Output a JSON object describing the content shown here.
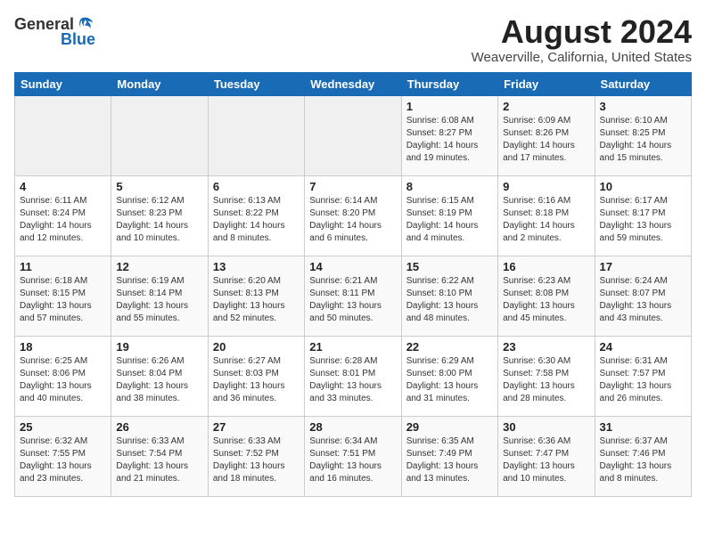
{
  "header": {
    "logo_general": "General",
    "logo_blue": "Blue",
    "month_year": "August 2024",
    "location": "Weaverville, California, United States"
  },
  "weekdays": [
    "Sunday",
    "Monday",
    "Tuesday",
    "Wednesday",
    "Thursday",
    "Friday",
    "Saturday"
  ],
  "weeks": [
    [
      {
        "day": "",
        "info": ""
      },
      {
        "day": "",
        "info": ""
      },
      {
        "day": "",
        "info": ""
      },
      {
        "day": "",
        "info": ""
      },
      {
        "day": "1",
        "info": "Sunrise: 6:08 AM\nSunset: 8:27 PM\nDaylight: 14 hours\nand 19 minutes."
      },
      {
        "day": "2",
        "info": "Sunrise: 6:09 AM\nSunset: 8:26 PM\nDaylight: 14 hours\nand 17 minutes."
      },
      {
        "day": "3",
        "info": "Sunrise: 6:10 AM\nSunset: 8:25 PM\nDaylight: 14 hours\nand 15 minutes."
      }
    ],
    [
      {
        "day": "4",
        "info": "Sunrise: 6:11 AM\nSunset: 8:24 PM\nDaylight: 14 hours\nand 12 minutes."
      },
      {
        "day": "5",
        "info": "Sunrise: 6:12 AM\nSunset: 8:23 PM\nDaylight: 14 hours\nand 10 minutes."
      },
      {
        "day": "6",
        "info": "Sunrise: 6:13 AM\nSunset: 8:22 PM\nDaylight: 14 hours\nand 8 minutes."
      },
      {
        "day": "7",
        "info": "Sunrise: 6:14 AM\nSunset: 8:20 PM\nDaylight: 14 hours\nand 6 minutes."
      },
      {
        "day": "8",
        "info": "Sunrise: 6:15 AM\nSunset: 8:19 PM\nDaylight: 14 hours\nand 4 minutes."
      },
      {
        "day": "9",
        "info": "Sunrise: 6:16 AM\nSunset: 8:18 PM\nDaylight: 14 hours\nand 2 minutes."
      },
      {
        "day": "10",
        "info": "Sunrise: 6:17 AM\nSunset: 8:17 PM\nDaylight: 13 hours\nand 59 minutes."
      }
    ],
    [
      {
        "day": "11",
        "info": "Sunrise: 6:18 AM\nSunset: 8:15 PM\nDaylight: 13 hours\nand 57 minutes."
      },
      {
        "day": "12",
        "info": "Sunrise: 6:19 AM\nSunset: 8:14 PM\nDaylight: 13 hours\nand 55 minutes."
      },
      {
        "day": "13",
        "info": "Sunrise: 6:20 AM\nSunset: 8:13 PM\nDaylight: 13 hours\nand 52 minutes."
      },
      {
        "day": "14",
        "info": "Sunrise: 6:21 AM\nSunset: 8:11 PM\nDaylight: 13 hours\nand 50 minutes."
      },
      {
        "day": "15",
        "info": "Sunrise: 6:22 AM\nSunset: 8:10 PM\nDaylight: 13 hours\nand 48 minutes."
      },
      {
        "day": "16",
        "info": "Sunrise: 6:23 AM\nSunset: 8:08 PM\nDaylight: 13 hours\nand 45 minutes."
      },
      {
        "day": "17",
        "info": "Sunrise: 6:24 AM\nSunset: 8:07 PM\nDaylight: 13 hours\nand 43 minutes."
      }
    ],
    [
      {
        "day": "18",
        "info": "Sunrise: 6:25 AM\nSunset: 8:06 PM\nDaylight: 13 hours\nand 40 minutes."
      },
      {
        "day": "19",
        "info": "Sunrise: 6:26 AM\nSunset: 8:04 PM\nDaylight: 13 hours\nand 38 minutes."
      },
      {
        "day": "20",
        "info": "Sunrise: 6:27 AM\nSunset: 8:03 PM\nDaylight: 13 hours\nand 36 minutes."
      },
      {
        "day": "21",
        "info": "Sunrise: 6:28 AM\nSunset: 8:01 PM\nDaylight: 13 hours\nand 33 minutes."
      },
      {
        "day": "22",
        "info": "Sunrise: 6:29 AM\nSunset: 8:00 PM\nDaylight: 13 hours\nand 31 minutes."
      },
      {
        "day": "23",
        "info": "Sunrise: 6:30 AM\nSunset: 7:58 PM\nDaylight: 13 hours\nand 28 minutes."
      },
      {
        "day": "24",
        "info": "Sunrise: 6:31 AM\nSunset: 7:57 PM\nDaylight: 13 hours\nand 26 minutes."
      }
    ],
    [
      {
        "day": "25",
        "info": "Sunrise: 6:32 AM\nSunset: 7:55 PM\nDaylight: 13 hours\nand 23 minutes."
      },
      {
        "day": "26",
        "info": "Sunrise: 6:33 AM\nSunset: 7:54 PM\nDaylight: 13 hours\nand 21 minutes."
      },
      {
        "day": "27",
        "info": "Sunrise: 6:33 AM\nSunset: 7:52 PM\nDaylight: 13 hours\nand 18 minutes."
      },
      {
        "day": "28",
        "info": "Sunrise: 6:34 AM\nSunset: 7:51 PM\nDaylight: 13 hours\nand 16 minutes."
      },
      {
        "day": "29",
        "info": "Sunrise: 6:35 AM\nSunset: 7:49 PM\nDaylight: 13 hours\nand 13 minutes."
      },
      {
        "day": "30",
        "info": "Sunrise: 6:36 AM\nSunset: 7:47 PM\nDaylight: 13 hours\nand 10 minutes."
      },
      {
        "day": "31",
        "info": "Sunrise: 6:37 AM\nSunset: 7:46 PM\nDaylight: 13 hours\nand 8 minutes."
      }
    ]
  ]
}
